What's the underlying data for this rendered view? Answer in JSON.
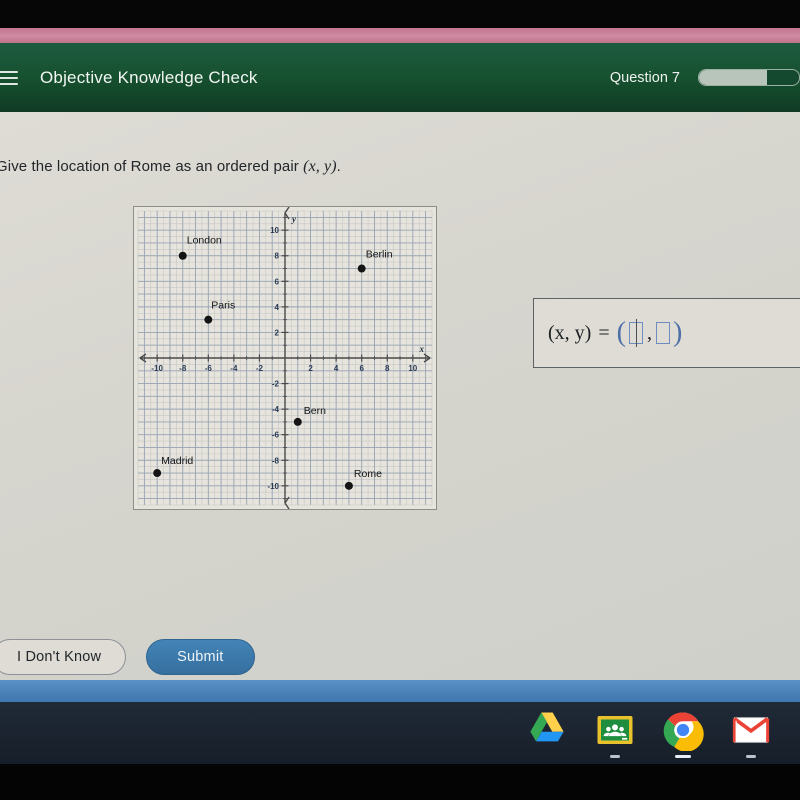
{
  "header": {
    "menu_icon": "hamburger-menu-icon",
    "title": "Objective Knowledge Check",
    "question_counter": "Question 7",
    "progress_percent": 68,
    "brand_color": "#18523a"
  },
  "question": {
    "text_plain": "Give the location of Rome as an ordered pair (x, y).",
    "text_lead": "Give the location of Rome as an ordered pair ",
    "text_math": "(x, y)",
    "text_tail": "."
  },
  "answer": {
    "label": "(x, y)",
    "equals": "=",
    "open_paren": "(",
    "close_paren": ")",
    "comma": ",",
    "x_value": "",
    "y_value": "",
    "x_placeholder": "",
    "y_placeholder": "",
    "accent_color": "#6d8cc0"
  },
  "footer": {
    "dont_know_label": "I Don't Know",
    "submit_label": "Submit",
    "submit_color": "#3b7aab"
  },
  "shelf": {
    "apps": [
      {
        "name": "google-drive-icon",
        "label": "Google Drive",
        "running": false
      },
      {
        "name": "google-classroom-icon",
        "label": "Google Classroom",
        "running": true
      },
      {
        "name": "google-chrome-icon",
        "label": "Google Chrome",
        "running": true
      },
      {
        "name": "gmail-icon",
        "label": "Gmail",
        "running": true
      }
    ]
  },
  "chart_data": {
    "type": "scatter",
    "title": "",
    "xlabel": "x",
    "ylabel": "y",
    "xlim": [
      -11.5,
      11.5
    ],
    "ylim": [
      -11.5,
      11.5
    ],
    "xticks": [
      -10,
      -8,
      -6,
      -4,
      -2,
      2,
      4,
      6,
      8,
      10
    ],
    "yticks": [
      10,
      8,
      6,
      4,
      2,
      -2,
      -4,
      -6,
      -8,
      -10
    ],
    "major_grid_step": 1,
    "minor_grid_per_major": 1,
    "grid": true,
    "grid_color": "#9aa4b4",
    "minor_grid_color": "#c2c6c4",
    "axis_color": "#4a4a4a",
    "point_color": "#141414",
    "legend": "none",
    "points": [
      {
        "label": "London",
        "x": -8,
        "y": 8,
        "label_dx": 4,
        "label_dy": -12
      },
      {
        "label": "Berlin",
        "x": 6,
        "y": 7,
        "label_dx": 4,
        "label_dy": -11
      },
      {
        "label": "Paris",
        "x": -6,
        "y": 3,
        "label_dx": 3,
        "label_dy": -11
      },
      {
        "label": "Bern",
        "x": 1,
        "y": -5,
        "label_dx": 6,
        "label_dy": -8
      },
      {
        "label": "Madrid",
        "x": -10,
        "y": -9,
        "label_dx": 4,
        "label_dy": -9
      },
      {
        "label": "Rome",
        "x": 5,
        "y": -10,
        "label_dx": 5,
        "label_dy": -9
      }
    ]
  }
}
